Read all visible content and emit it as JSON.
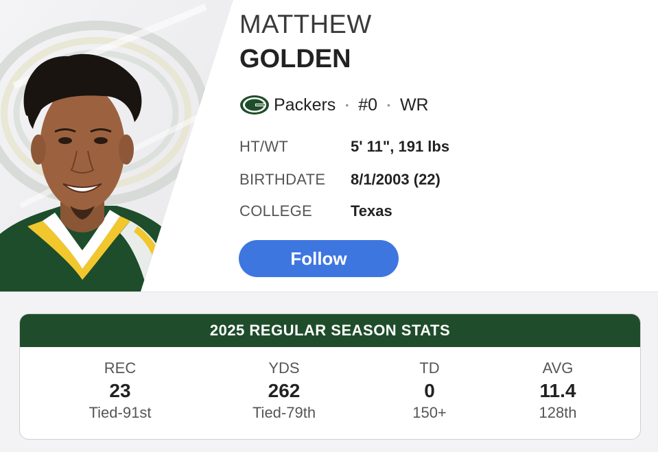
{
  "player": {
    "first_name": "MATTHEW",
    "last_name": "GOLDEN",
    "team": "Packers",
    "number": "#0",
    "position": "WR",
    "separator": "•"
  },
  "bio": [
    {
      "label": "HT/WT",
      "value": "5' 11\", 191 lbs"
    },
    {
      "label": "BIRTHDATE",
      "value": "8/1/2003 (22)"
    },
    {
      "label": "COLLEGE",
      "value": "Texas"
    }
  ],
  "follow_label": "Follow",
  "stats": {
    "title": "2025 REGULAR SEASON STATS",
    "columns": [
      {
        "label": "REC",
        "value": "23",
        "rank": "Tied-91st"
      },
      {
        "label": "YDS",
        "value": "262",
        "rank": "Tied-79th"
      },
      {
        "label": "TD",
        "value": "0",
        "rank": "150+"
      },
      {
        "label": "AVG",
        "value": "11.4",
        "rank": "128th"
      }
    ]
  },
  "colors": {
    "team_green": "#1f4d2b",
    "team_gold": "#f2c72e",
    "follow_blue": "#3e76e0"
  },
  "icons": {
    "team_logo": "packers-g-logo-icon",
    "player_photo": "player-headshot"
  }
}
